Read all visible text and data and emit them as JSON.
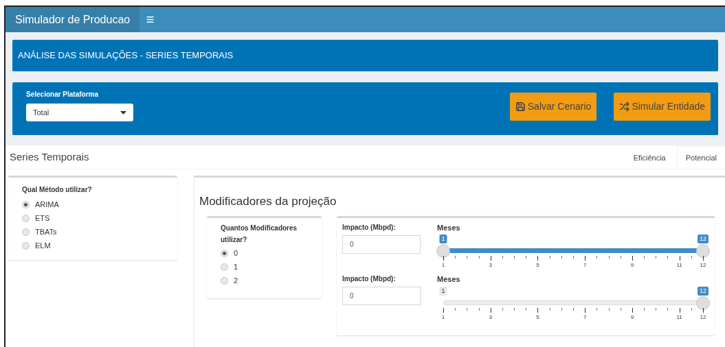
{
  "header": {
    "title": "Simulador de Producao"
  },
  "banner": {
    "title": "ANÁLISE DAS SIMULAÇÕES - SERIES TEMPORAIS"
  },
  "controls": {
    "select": {
      "label": "Selecionar Plataforma",
      "value": "Total"
    },
    "buttons": [
      {
        "label": "Salvar Cenario",
        "kind": "save"
      },
      {
        "label": "Simular Entidade",
        "kind": "shuffle"
      }
    ]
  },
  "tabbox": {
    "title": "Series Temporais",
    "tabs": [
      {
        "label": "Eficiência",
        "selected": false
      },
      {
        "label": "Potencial",
        "selected": true
      }
    ]
  },
  "method": {
    "label": "Qual Método utilizar?",
    "options": [
      {
        "label": "ARIMA",
        "selected": true
      },
      {
        "label": "ETS",
        "selected": false
      },
      {
        "label": "TBATs",
        "selected": false
      },
      {
        "label": "ELM",
        "selected": false
      }
    ]
  },
  "modifiers": {
    "title": "Modificadores da projeção",
    "count": {
      "label": "Quantos Modificadores utilizar?",
      "options": [
        {
          "label": "0",
          "selected": true
        },
        {
          "label": "1",
          "selected": false
        },
        {
          "label": "2",
          "selected": false
        }
      ]
    },
    "rows": [
      {
        "input_label": "Impacto (Mbpd):",
        "value": "0",
        "slider_label": "Meses",
        "kind": "range",
        "from": "1",
        "to": "12",
        "level": 1,
        "ticks": [
          "1",
          "3",
          "5",
          "7",
          "9",
          "11",
          "12"
        ]
      },
      {
        "input_label": "Impacto (Mbpd):",
        "value": "0",
        "slider_label": "Meses",
        "kind": "single",
        "min": "1",
        "to": "12",
        "level": 1,
        "ticks": [
          "1",
          "3",
          "5",
          "7",
          "9",
          "11",
          "12"
        ]
      }
    ]
  }
}
